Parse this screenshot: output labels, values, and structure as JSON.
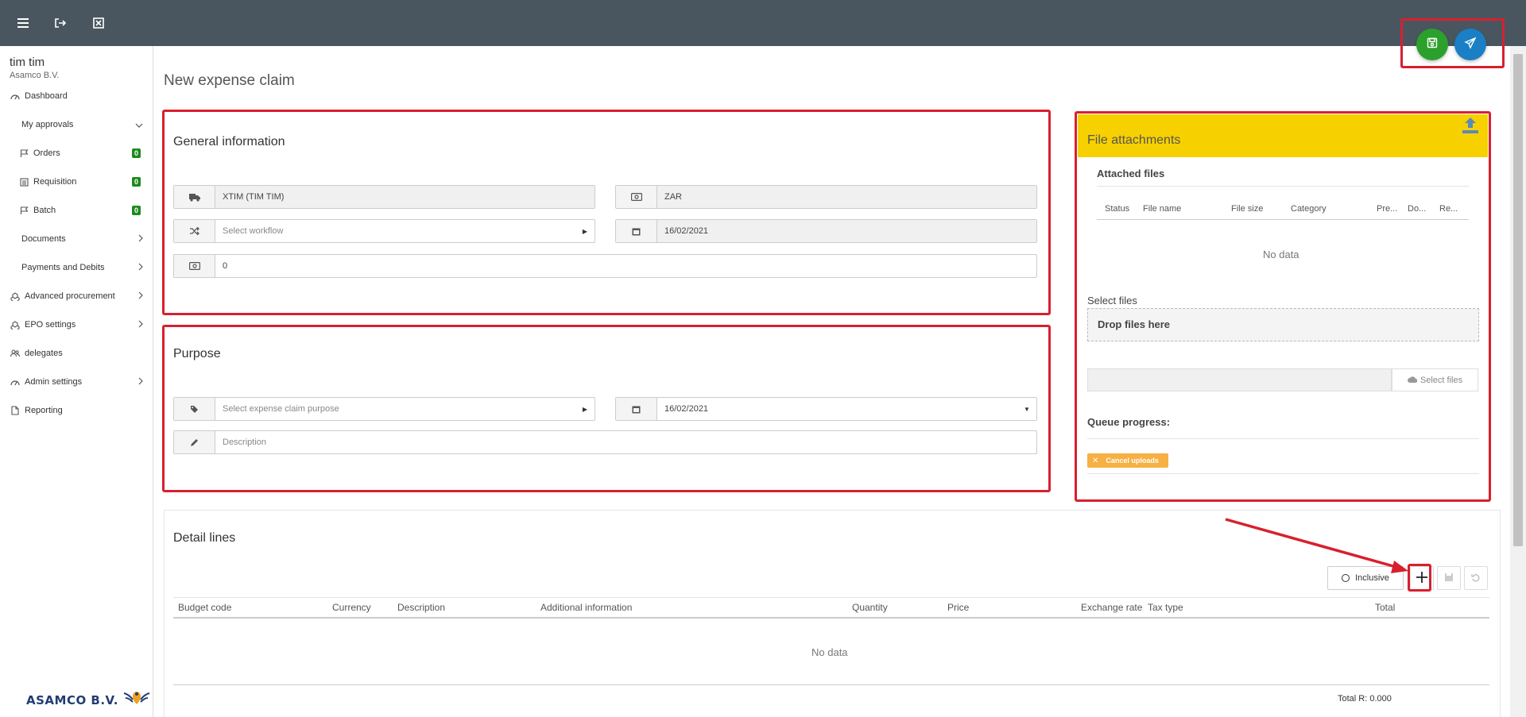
{
  "topbar": {
    "menu_icon": "hamburger-icon",
    "exit_icon": "sign-out-icon",
    "close_icon": "close-box-icon",
    "save_icon": "floppy-disk-icon",
    "submit_icon": "paper-plane-icon",
    "color": "#4a565f"
  },
  "sidebar": {
    "user_name": "tim tim",
    "user_org": "Asamco B.V.",
    "items": [
      {
        "label": "Dashboard",
        "icon": "dashboard-icon"
      },
      {
        "label": "My approvals",
        "icon": ""
      },
      {
        "label": "Orders",
        "icon": "flag-icon",
        "badge": "0"
      },
      {
        "label": "Requisition",
        "icon": "list-icon",
        "badge": "0"
      },
      {
        "label": "Batch",
        "icon": "flag-icon",
        "badge": "0"
      },
      {
        "label": "Documents",
        "icon": ""
      },
      {
        "label": "Payments and Debits",
        "icon": ""
      },
      {
        "label": "Advanced procurement",
        "icon": "cubes-icon"
      },
      {
        "label": "EPO settings",
        "icon": "cubes-icon"
      },
      {
        "label": "delegates",
        "icon": "users-icon"
      },
      {
        "label": "Admin settings",
        "icon": "gauge-icon"
      },
      {
        "label": "Reporting",
        "icon": "file-icon"
      }
    ],
    "logo_text": "ASAMCO B.V."
  },
  "page": {
    "title": "New expense claim"
  },
  "general": {
    "title": "General information",
    "supplier": "XTIM (TIM TIM)",
    "currency": "ZAR",
    "workflow_placeholder": "Select workflow",
    "date": "16/02/2021",
    "amount": "0"
  },
  "purpose": {
    "title": "Purpose",
    "purpose_placeholder": "Select expense claim purpose",
    "date": "16/02/2021",
    "description_placeholder": "Description"
  },
  "attachments": {
    "title": "File attachments",
    "attached_files_label": "Attached files",
    "columns": [
      "Status",
      "File name",
      "File size",
      "Category",
      "Pre...",
      "Do...",
      "Re..."
    ],
    "no_data": "No data",
    "select_files_label": "Select files",
    "drop_text": "Drop files here",
    "select_button": "Select files",
    "queue_label": "Queue progress:",
    "cancel_button": "Cancel uploads",
    "header_color": "#f7d000"
  },
  "detail_lines": {
    "title": "Detail lines",
    "inclusive_label": "Inclusive",
    "columns": [
      "Budget code",
      "Currency",
      "Description",
      "Additional information",
      "Quantity",
      "Price",
      "Exchange rate",
      "Tax type",
      "Total"
    ],
    "no_data": "No data",
    "total_text": "Total R: 0.000"
  },
  "annotation_color": "#d8202d"
}
